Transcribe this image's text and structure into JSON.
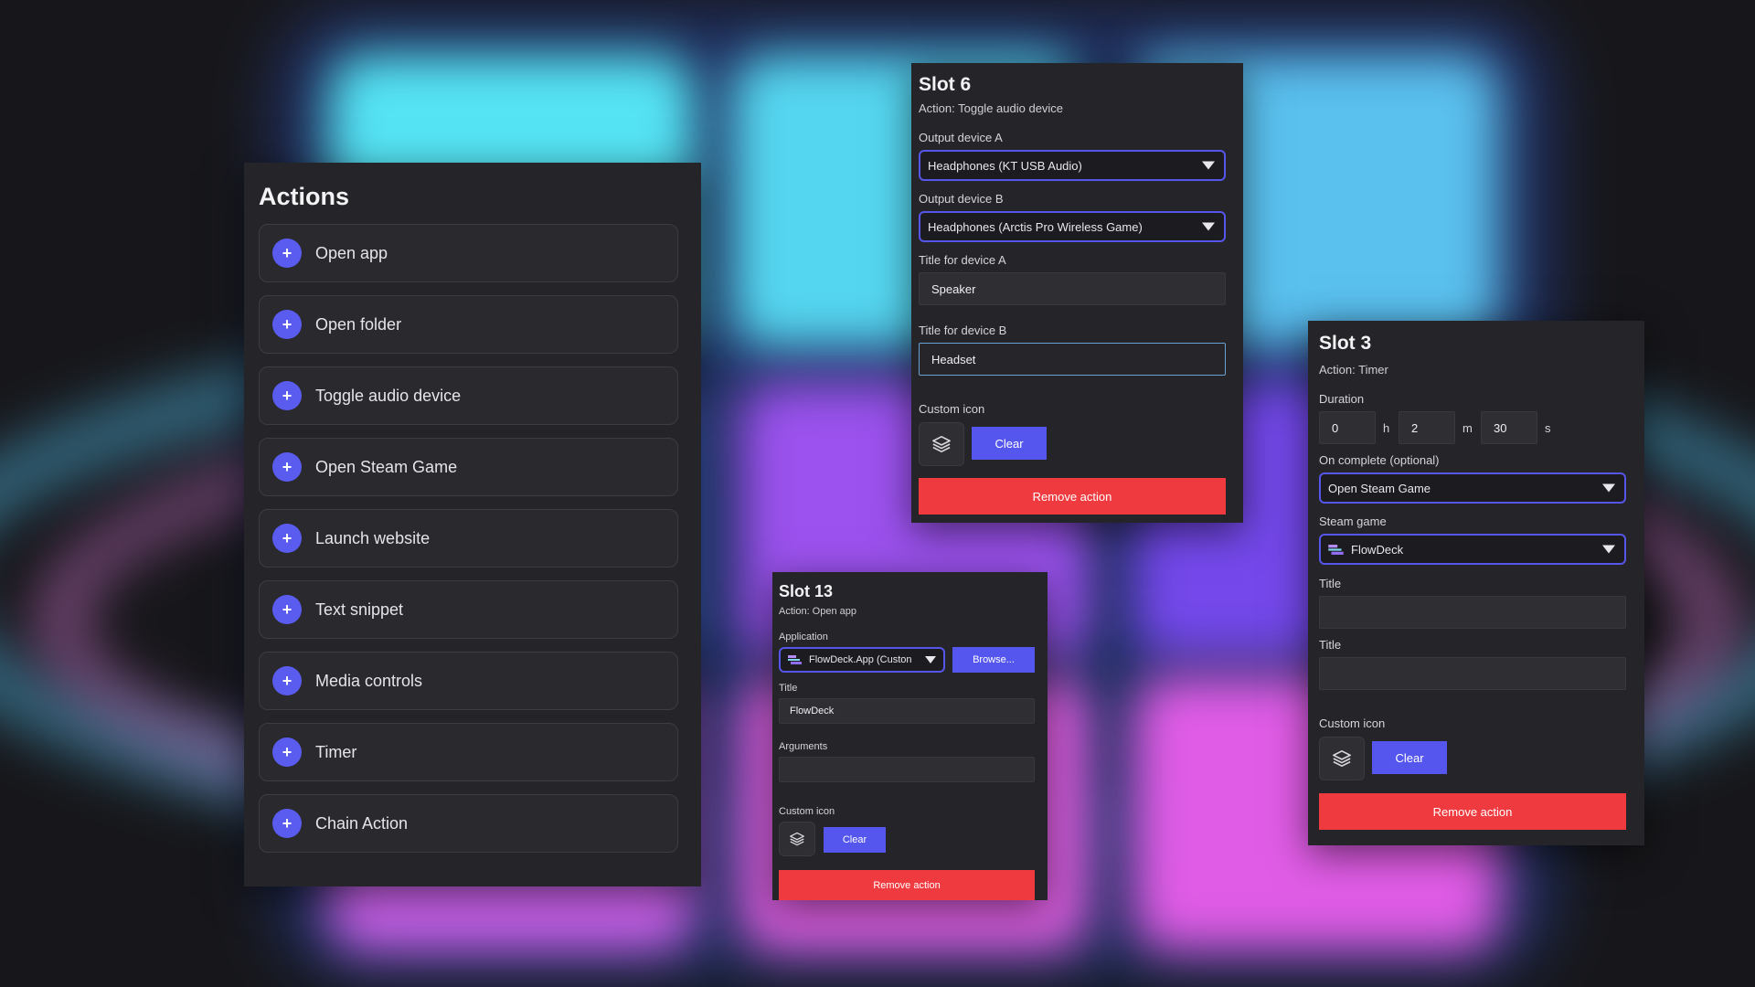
{
  "actions_panel": {
    "title": "Actions",
    "items": [
      {
        "label": "Open app"
      },
      {
        "label": "Open folder"
      },
      {
        "label": "Toggle audio device"
      },
      {
        "label": "Open Steam Game"
      },
      {
        "label": "Launch website"
      },
      {
        "label": "Text snippet"
      },
      {
        "label": "Media controls"
      },
      {
        "label": "Timer"
      },
      {
        "label": "Chain Action"
      }
    ],
    "add_glyph": "+"
  },
  "slot6": {
    "title": "Slot 6",
    "action": "Action: Toggle audio device",
    "output_a_label": "Output device A",
    "output_a_value": "Headphones (KT USB Audio)",
    "output_b_label": "Output device B",
    "output_b_value": "Headphones (Arctis Pro Wireless Game)",
    "title_a_label": "Title for device A",
    "title_a_value": "Speaker",
    "title_b_label": "Title for device B",
    "title_b_value": "Headset",
    "custom_icon_label": "Custom icon",
    "clear_label": "Clear",
    "remove_label": "Remove action"
  },
  "slot3": {
    "title": "Slot 3",
    "action": "Action: Timer",
    "duration_label": "Duration",
    "hours": "0",
    "hours_unit": "h",
    "minutes": "2",
    "minutes_unit": "m",
    "seconds": "30",
    "seconds_unit": "s",
    "on_complete_label": "On complete (optional)",
    "on_complete_value": "Open Steam Game",
    "steam_game_label": "Steam game",
    "steam_game_value": "FlowDeck",
    "title_label_1": "Title",
    "title_value_1": "",
    "title_label_2": "Title",
    "title_value_2": "",
    "custom_icon_label": "Custom icon",
    "clear_label": "Clear",
    "remove_label": "Remove action"
  },
  "slot13": {
    "title": "Slot 13",
    "action": "Action: Open app",
    "application_label": "Application",
    "application_value": "FlowDeck.App (Custon",
    "browse_label": "Browse...",
    "title_label": "Title",
    "title_value": "FlowDeck",
    "arguments_label": "Arguments",
    "arguments_value": "",
    "custom_icon_label": "Custom icon",
    "clear_label": "Clear",
    "remove_label": "Remove action"
  },
  "colors": {
    "accent": "#5456ee",
    "danger": "#ef3a3f",
    "panel": "#252529",
    "focus": "#6aa2d8"
  },
  "icons": {
    "add": "plus-icon",
    "layers": "layers-icon",
    "dropdown": "chevron-down-icon",
    "app": "flowdeck-logo-icon"
  }
}
